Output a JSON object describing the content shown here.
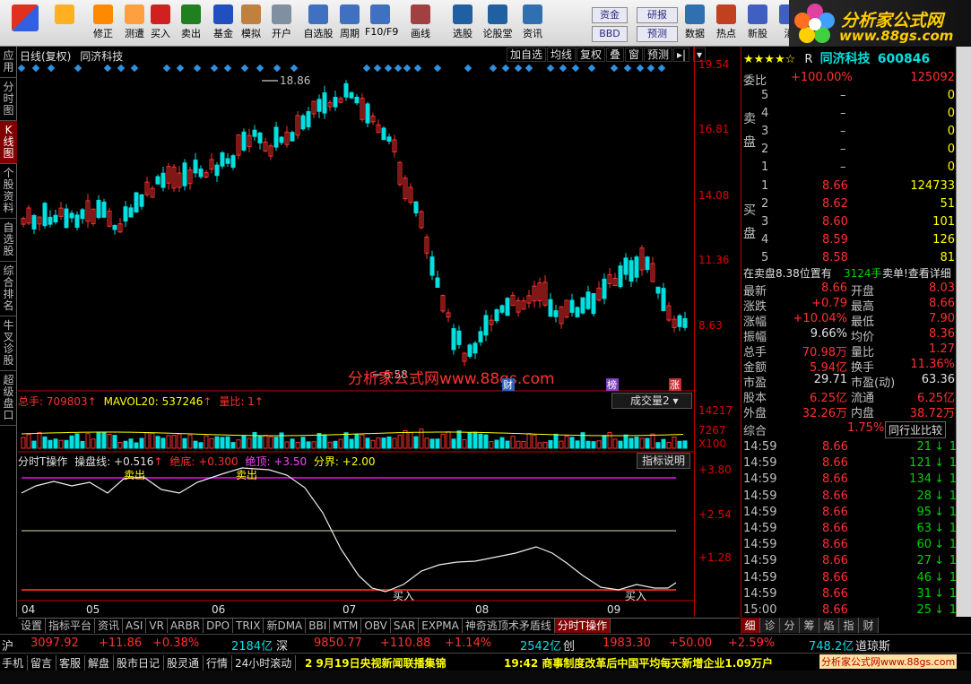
{
  "toolbar": {
    "buttons": [
      {
        "name": "back",
        "label": ""
      },
      {
        "name": "revise",
        "label": "修正"
      },
      {
        "name": "test",
        "label": "测遭"
      },
      {
        "name": "buy",
        "label": "买入"
      },
      {
        "name": "sell",
        "label": "卖出"
      },
      {
        "name": "fund",
        "label": "基金"
      },
      {
        "name": "simulate",
        "label": "模拟"
      },
      {
        "name": "open-account",
        "label": "开户"
      },
      {
        "name": "watchlist",
        "label": "自选股"
      },
      {
        "name": "period",
        "label": "周期"
      },
      {
        "name": "f10",
        "label": "F10/F9"
      },
      {
        "name": "draw",
        "label": "画线"
      },
      {
        "name": "stock-select",
        "label": "选股"
      },
      {
        "name": "forum",
        "label": "论股堂"
      },
      {
        "name": "info",
        "label": "资讯"
      },
      {
        "name": "data",
        "label": "数据"
      },
      {
        "name": "hot",
        "label": "热点"
      },
      {
        "name": "newstock",
        "label": "新股"
      },
      {
        "name": "more",
        "label": "消"
      }
    ],
    "small": {
      "capital": "资金",
      "bbd": "BBD",
      "research": "研报",
      "forecast": "预测"
    }
  },
  "logo": {
    "line1": "分析家公式网",
    "line2": "www.88gs.com"
  },
  "left_tabs": [
    "应用",
    "分时图",
    "K线图",
    "个股资料",
    "自选股",
    "综合排名",
    "牛叉诊股",
    "超级盘口"
  ],
  "chart": {
    "title": "日线(复权)",
    "stock": "同济科技",
    "tools": [
      "加自选",
      "均线",
      "复权",
      "叠",
      "窗",
      "预测"
    ],
    "high_label": "18.86",
    "low_label": "6.58",
    "axis_prices": [
      "19.54",
      "16.81",
      "14.08",
      "11.36",
      "8.63"
    ],
    "months": [
      "04",
      "05",
      "06",
      "07",
      "08",
      "09"
    ],
    "watermark": "分析家公式网www.88gs.com",
    "flags": [
      "财",
      "榜",
      "涨"
    ],
    "vol_legend": {
      "total": "总手: 709803",
      "mavol": "MAVOL20: 537246",
      "ratio": "量比: 1"
    },
    "vol_dropdown": "成交量2",
    "vol_axis": [
      "14217",
      "7267",
      "X100"
    ],
    "ind_legend": {
      "name": "分时T操作",
      "op": "操盘线: +0.516",
      "bottom": "绝底: +0.300",
      "top": "绝顶: +3.50",
      "split": "分界: +2.00"
    },
    "ind_help": "指标说明",
    "ind_axis": [
      "+3.80",
      "+2.54",
      "+1.28"
    ],
    "sell_label": "卖出",
    "buy_label": "买入"
  },
  "bottom_tabs": [
    "设置",
    "指标平台",
    "资讯",
    "ASI",
    "VR",
    "ARBR",
    "DPO",
    "TRIX",
    "新DMA",
    "BBI",
    "MTM",
    "OBV",
    "SAR",
    "EXPMA",
    "神奇逃顶术矛盾线",
    "分时T操作"
  ],
  "right": {
    "stars": "★★★★☆",
    "flag": "R",
    "name": "同济科技",
    "code": "600846",
    "weibi_label": "委比",
    "weibi_pct": "+100.00%",
    "weibi_val": "125092",
    "sell_label": "卖盘",
    "buy_label": "买盘",
    "sells": [
      [
        "5",
        "–",
        "0"
      ],
      [
        "4",
        "–",
        "0"
      ],
      [
        "3",
        "–",
        "0"
      ],
      [
        "2",
        "–",
        "0"
      ],
      [
        "1",
        "–",
        "0"
      ]
    ],
    "buys": [
      [
        "1",
        "8.66",
        "124733"
      ],
      [
        "2",
        "8.62",
        "51"
      ],
      [
        "3",
        "8.60",
        "101"
      ],
      [
        "4",
        "8.59",
        "126"
      ],
      [
        "5",
        "8.58",
        "81"
      ]
    ],
    "pos_note": "在卖盘8.38位置有",
    "pos_val": "3124手",
    "pos_tail": "卖单!查看详细",
    "stats": [
      [
        "最新",
        "8.66",
        "开盘",
        "8.03"
      ],
      [
        "涨跌",
        "+0.79",
        "最高",
        "8.66"
      ],
      [
        "涨幅",
        "+10.04%",
        "最低",
        "7.90"
      ],
      [
        "振幅",
        "9.66%",
        "均价",
        "8.36"
      ],
      [
        "总手",
        "70.98万",
        "量比",
        "1.27"
      ],
      [
        "金额",
        "5.94亿",
        "换手",
        "11.36%"
      ],
      [
        "市盈",
        "29.71",
        "市盈(动)",
        "63.36"
      ],
      [
        "股本",
        "6.25亿",
        "流通",
        "6.25亿"
      ],
      [
        "外盘",
        "32.26万",
        "内盘",
        "38.72万"
      ]
    ],
    "compre": "综合",
    "compre_pct": "1.75%",
    "compare_btn": "同行业比较",
    "ticks": [
      [
        "14:59",
        "8.66",
        "21"
      ],
      [
        "14:59",
        "8.66",
        "121"
      ],
      [
        "14:59",
        "8.66",
        "134"
      ],
      [
        "14:59",
        "8.66",
        "28"
      ],
      [
        "14:59",
        "8.66",
        "95"
      ],
      [
        "14:59",
        "8.66",
        "63"
      ],
      [
        "14:59",
        "8.66",
        "60"
      ],
      [
        "14:59",
        "8.66",
        "27"
      ],
      [
        "14:59",
        "8.66",
        "46"
      ],
      [
        "14:59",
        "8.66",
        "31"
      ],
      [
        "15:00",
        "8.66",
        "25"
      ]
    ],
    "tabs": [
      "细",
      "诊",
      "分",
      "筹",
      "焰",
      "指",
      "财"
    ]
  },
  "status1": {
    "sh_label": "沪",
    "sh_idx": "3097.92",
    "sh_chg": "+11.86",
    "sh_pct": "+0.38%",
    "sh_amt": "2184亿",
    "sz_label": "深",
    "sz_idx": "9850.77",
    "sz_chg": "+110.88",
    "sz_pct": "+1.14%",
    "sz_amt": "2542亿",
    "cy_label": "创",
    "cy_idx": "1983.30",
    "cy_chg": "+50.00",
    "cy_pct": "+2.59%",
    "cy_amt": "748.2亿",
    "dj_label": "道琼斯"
  },
  "status2": {
    "items": [
      "手机",
      "留言",
      "客服",
      "解盘",
      "股市日记",
      "股灵通",
      "行情",
      "24小时滚动"
    ],
    "news1": "2 9月19日央视新闻联播集锦",
    "news2": "19:42 商事制度改革后中国平均每天新增企业1.09万户",
    "brand": "分析家公式网www.88gs.com"
  }
}
